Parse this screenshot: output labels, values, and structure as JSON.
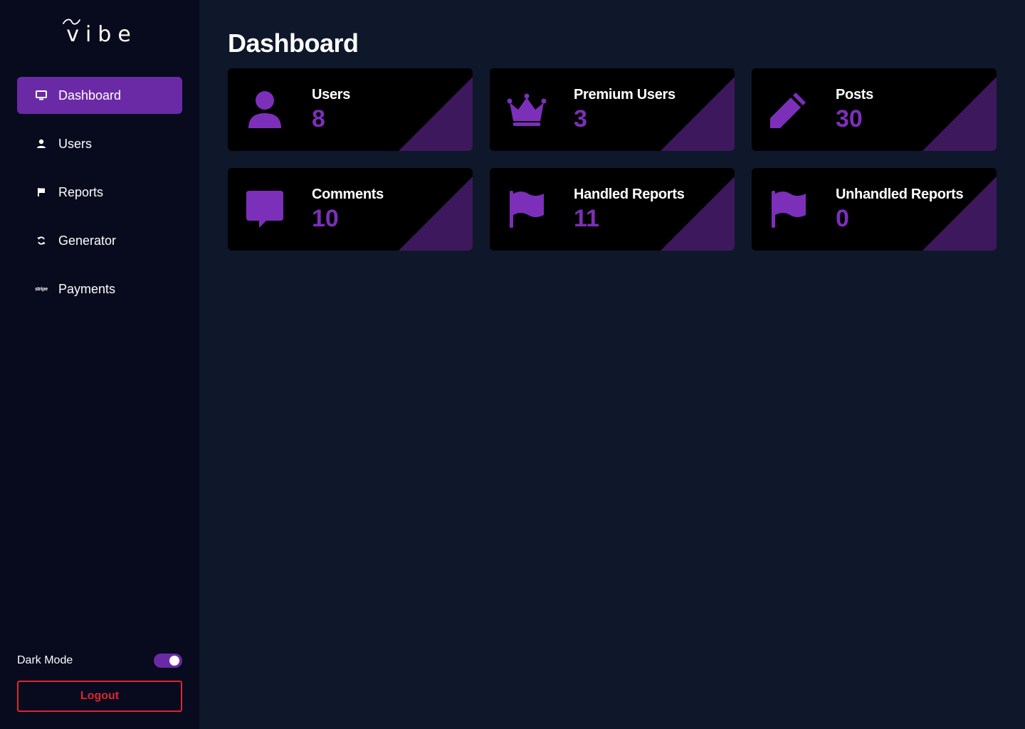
{
  "app": {
    "logo_text": "vibe"
  },
  "colors": {
    "accent": "#6b2aa5",
    "icon_purple": "#7c2fb8",
    "card_corner": "#3d185c",
    "logout_red": "#e0252e",
    "sidebar_bg": "#070b1d",
    "main_bg": "#0f172a"
  },
  "sidebar": {
    "items": [
      {
        "label": "Dashboard",
        "icon": "monitor-icon",
        "active": true
      },
      {
        "label": "Users",
        "icon": "user-icon",
        "active": false
      },
      {
        "label": "Reports",
        "icon": "flag-icon",
        "active": false
      },
      {
        "label": "Generator",
        "icon": "refresh-icon",
        "active": false
      },
      {
        "label": "Payments",
        "icon": "stripe-icon",
        "icon_text": "stripe",
        "active": false
      }
    ],
    "dark_mode_label": "Dark Mode",
    "dark_mode_on": true,
    "logout_label": "Logout"
  },
  "main": {
    "title": "Dashboard",
    "cards": [
      {
        "label": "Users",
        "value": "8",
        "icon": "user-icon"
      },
      {
        "label": "Premium Users",
        "value": "3",
        "icon": "crown-icon"
      },
      {
        "label": "Posts",
        "value": "30",
        "icon": "pencil-icon"
      },
      {
        "label": "Comments",
        "value": "10",
        "icon": "comment-icon"
      },
      {
        "label": "Handled Reports",
        "value": "11",
        "icon": "flag-icon"
      },
      {
        "label": "Unhandled Reports",
        "value": "0",
        "icon": "flag-icon"
      }
    ]
  }
}
